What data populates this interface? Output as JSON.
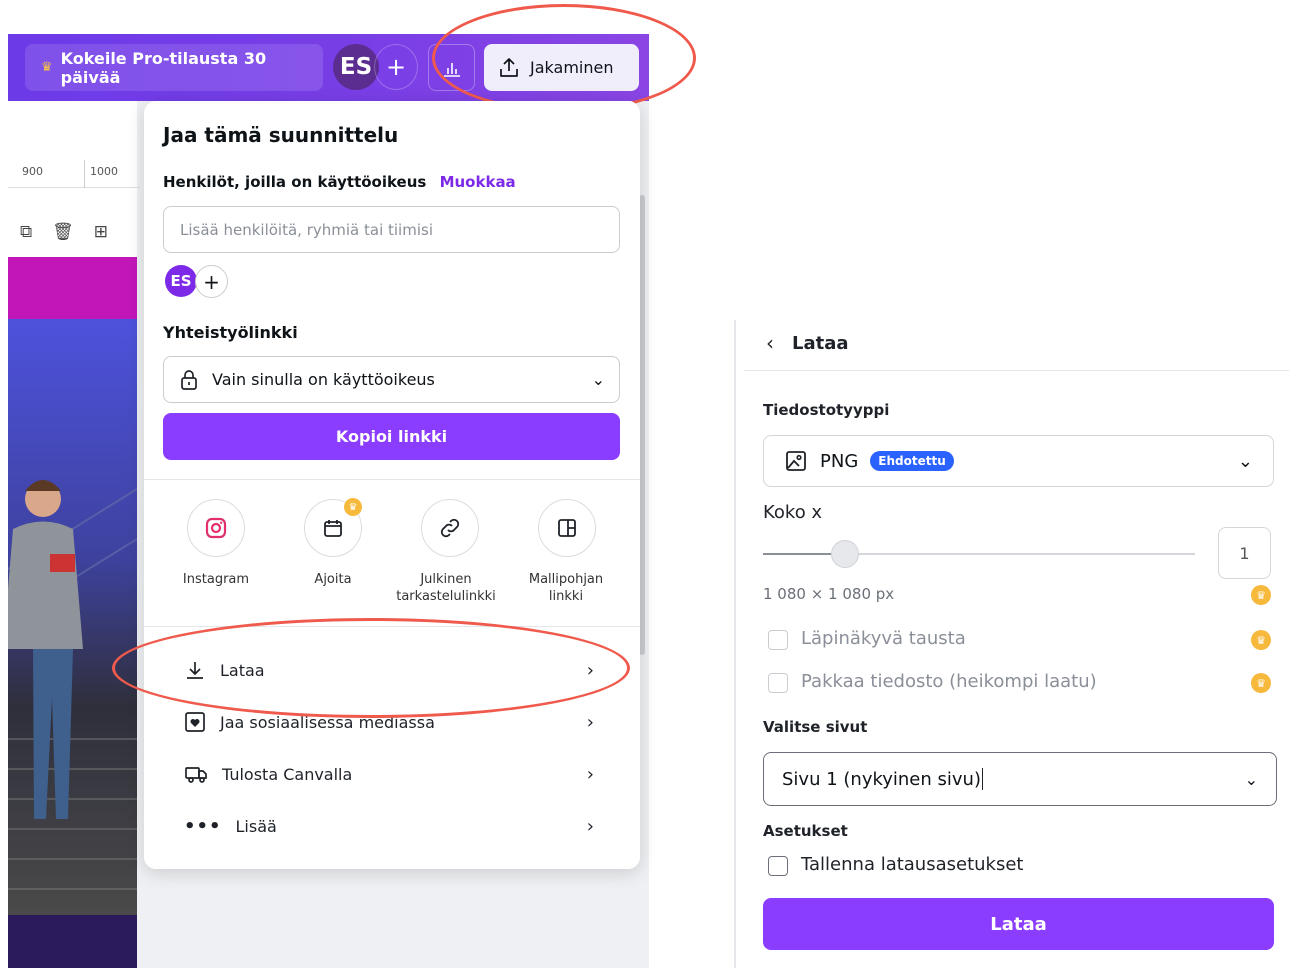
{
  "topbar": {
    "pro_label": "Kokeile Pro-tilausta 30 päivää",
    "avatar": "ES",
    "share_label": "Jakaminen"
  },
  "ruler": {
    "left": "900",
    "right": "1000"
  },
  "share_panel": {
    "title": "Jaa tämä suunnittelu",
    "access_label": "Henkilöt, joilla on käyttöoikeus",
    "edit_link": "Muokkaa",
    "people_placeholder": "Lisää henkilöitä, ryhmiä tai tiimisi",
    "avatar": "ES",
    "collab_label": "Yhteistyölinkki",
    "access_value": "Vain sinulla on käyttöoikeus",
    "copy_link": "Kopioi linkki",
    "share_options": [
      {
        "label": "Instagram",
        "icon": "instagram-icon"
      },
      {
        "label": "Ajoita",
        "icon": "calendar-icon"
      },
      {
        "label": "Julkinen tarkastelulinkki",
        "icon": "link-icon"
      },
      {
        "label": "Mallipohjan linkki",
        "icon": "template-icon"
      }
    ],
    "menu": [
      {
        "label": "Lataa",
        "icon": "download-icon"
      },
      {
        "label": "Jaa sosiaalisessa mediassa",
        "icon": "heart-icon"
      },
      {
        "label": "Tulosta Canvalla",
        "icon": "truck-icon"
      },
      {
        "label": "Lisää",
        "icon": "more-icon"
      }
    ]
  },
  "download_panel": {
    "title": "Lataa",
    "filetype_label": "Tiedostotyyppi",
    "filetype_value": "PNG",
    "filetype_tag": "Ehdotettu",
    "size_label": "Koko x",
    "size_value": "1",
    "size_fraction": 0.19,
    "dimensions": "1 080 × 1 080 px",
    "transparent_bg": "Läpinäkyvä tausta",
    "compress": "Pakkaa tiedosto (heikompi laatu)",
    "pages_label": "Valitse sivut",
    "pages_value": "Sivu 1 (nykyinen sivu)",
    "settings_label": "Asetukset",
    "save_settings": "Tallenna latausasetukset",
    "download_button": "Lataa"
  },
  "colors": {
    "brand": "#8b3dff",
    "highlight": "#ef5a4c",
    "tag": "#2962ff",
    "crown": "#f6b93b"
  }
}
